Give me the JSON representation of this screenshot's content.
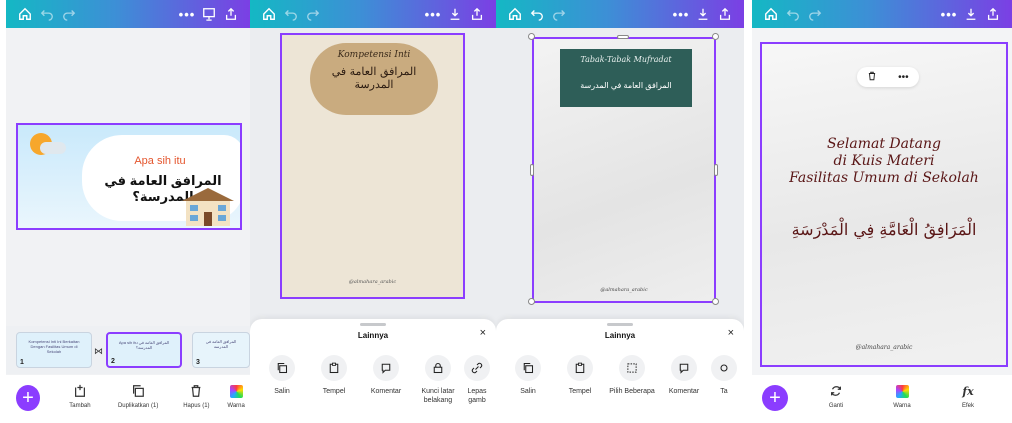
{
  "panel1": {
    "slide": {
      "line1": "Apa sih itu",
      "line2": "المرافق العامة في المدرسة؟"
    },
    "thumbnails": [
      {
        "num": "1",
        "text": "Kompetensi Inti Ini Berkaitan Dengan Fasilitas Umum di Sekolah"
      },
      {
        "num": "2",
        "text": "Apa sih itu المرافق العامة في المدرسة؟"
      },
      {
        "num": "3",
        "text": "المرافق العامة في المدرسة"
      }
    ],
    "thumb_badge": "2",
    "tools": [
      {
        "label": "Tambah",
        "icon": "add-page-icon"
      },
      {
        "label": "Duplikatkan (1)",
        "icon": "duplicate-icon"
      },
      {
        "label": "Hapus (1)",
        "icon": "trash-icon"
      },
      {
        "label": "Warna",
        "icon": "color-icon"
      }
    ]
  },
  "panel2": {
    "title_latin": "Kompetensi Inti",
    "title_arabic": "المرافق العامة في المدرسة",
    "handle": "@almahara_arabic",
    "sheet": {
      "title": "Lainnya",
      "close": "×",
      "options": [
        {
          "label": "Salin",
          "icon": "copy-icon"
        },
        {
          "label": "Tempel",
          "icon": "paste-icon"
        },
        {
          "label": "Komentar",
          "icon": "comment-icon"
        },
        {
          "label": "Kunci latar belakang",
          "icon": "lock-icon"
        },
        {
          "label": "Lepas gamb",
          "icon": "unlink-icon"
        }
      ]
    }
  },
  "panel3": {
    "title_latin": "Tabak-Tabak Mufradat",
    "title_arabic": "المرافق العامة في المدرسة",
    "handle": "@almahara_arabic",
    "sheet": {
      "title": "Lainnya",
      "close": "×",
      "options": [
        {
          "label": "Salin",
          "icon": "copy-icon"
        },
        {
          "label": "Tempel",
          "icon": "paste-icon"
        },
        {
          "label": "Pilih Beberapa",
          "icon": "select-multiple-icon"
        },
        {
          "label": "Komentar",
          "icon": "comment-icon"
        },
        {
          "label": "Ta",
          "icon": "more-icon"
        }
      ]
    }
  },
  "panel4": {
    "title_latin": [
      "Selamat Datang",
      "di Kuis Materi",
      "Fasilitas Umum di Sekolah"
    ],
    "title_arabic": "الْمَرَافِقُ الْعَامَّةِ فِي الْمَدْرَسَةِ",
    "handle": "@almahara_arabic",
    "float_more": "•••",
    "tools": [
      {
        "label": "Ganti",
        "icon": "replace-icon"
      },
      {
        "label": "Warna",
        "icon": "color-icon"
      },
      {
        "label": "Efek",
        "icon": "effects-icon"
      }
    ]
  },
  "topbar": {
    "more": "•••"
  },
  "colors": {
    "accent": "#8b3dff",
    "gradient_start": "#14b8c4",
    "gradient_end": "#7b3fe4"
  }
}
